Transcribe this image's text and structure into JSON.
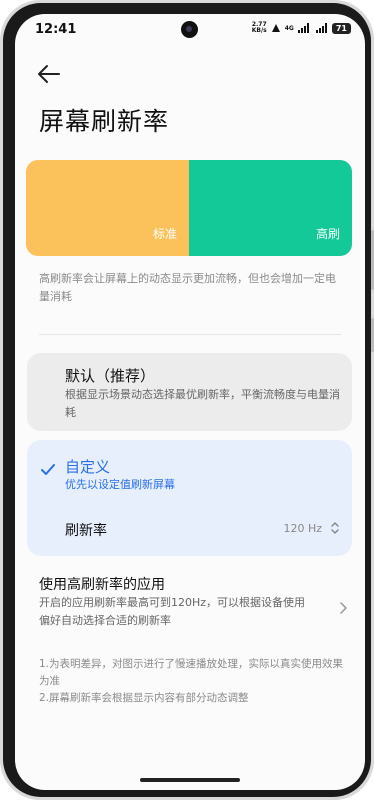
{
  "status_bar": {
    "time": "12:41",
    "net_speed_value": "2.77",
    "net_speed_unit": "KB/s",
    "network_type": "4G",
    "battery": "71"
  },
  "page": {
    "title": "屏幕刷新率"
  },
  "preview": {
    "left_label": "标准",
    "right_label": "高刷",
    "left_color": "#fbc25b",
    "right_color": "#13c997"
  },
  "description": "高刷新率会让屏幕上的动态显示更加流畅，但也会增加一定电量消耗",
  "options": {
    "default": {
      "title": "默认（推荐）",
      "desc": "根据显示场景动态选择最优刷新率，平衡流畅度与电量消耗"
    },
    "custom": {
      "title": "自定义",
      "subtitle": "优先以设定值刷新屏幕",
      "rate_label": "刷新率",
      "rate_value": "120 Hz"
    }
  },
  "apps": {
    "title": "使用高刷新率的应用",
    "desc": "开启的应用刷新率最高可到120Hz，可以根据设备使用偏好自动选择合适的刷新率"
  },
  "notes": [
    "1.为表明差异，对图示进行了慢速播放处理，实际以真实使用效果为准",
    "2.屏幕刷新率会根据显示内容有部分动态调整"
  ],
  "colors": {
    "accent": "#2a6fe8",
    "selected_card_bg": "#e7effd"
  }
}
